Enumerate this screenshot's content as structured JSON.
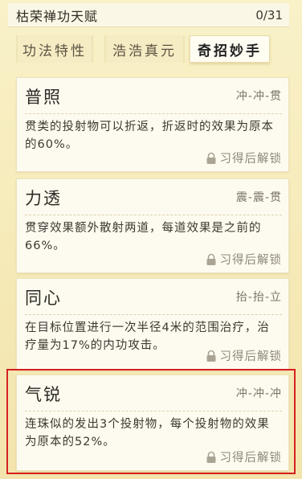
{
  "header": {
    "title": "枯荣禅功天赋",
    "count": "0/31"
  },
  "tabs": [
    {
      "label": "功法特性",
      "active": false
    },
    {
      "label": "浩浩真元",
      "active": false
    },
    {
      "label": "奇招妙手",
      "active": true
    }
  ],
  "talents": [
    {
      "name": "普照",
      "moves": "冲-冲-贯",
      "description": "贯类的投射物可以折返，折返时的效果为原本的60%。",
      "unlock": "习得后解锁"
    },
    {
      "name": "力透",
      "moves": "震-震-贯",
      "description": "贯穿效果额外散射两道，每道效果是之前的66%。",
      "unlock": "习得后解锁"
    },
    {
      "name": "同心",
      "moves": "抬-抬-立",
      "description": "在目标位置进行一次半径4米的范围治疗，治疗量为17%的内功攻击。",
      "unlock": "习得后解锁"
    },
    {
      "name": "气锐",
      "moves": "冲-冲-冲",
      "description": "连珠似的发出3个投射物，每个投射物的效果为原本的52%。",
      "unlock": "习得后解锁"
    }
  ],
  "colors": {
    "background": "#f7eec0",
    "highlight": "#d62020"
  },
  "icons": {
    "unlock": "lock-icon"
  }
}
